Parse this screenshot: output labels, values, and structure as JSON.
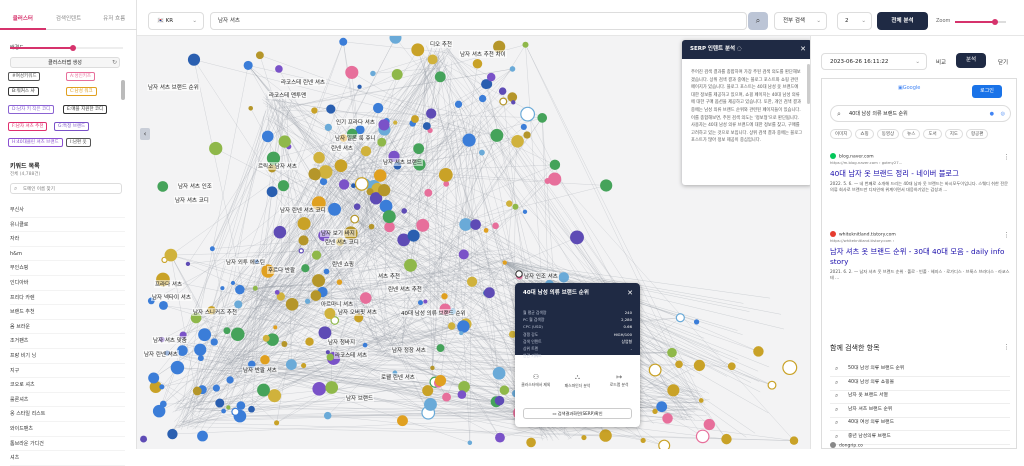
{
  "left_panel": {
    "tabs": [
      "클러스터",
      "검색인텐트",
      "유저 흐름"
    ],
    "active_tab": 0,
    "size_label": "배경도",
    "size_value": 0.56,
    "cluster_button": "클러스터맵 생성",
    "chips": [
      {
        "label": "#여성키워드",
        "color": "#555"
      },
      {
        "label": "A:성인키즈",
        "color": "#e76f9b"
      },
      {
        "label": "B:워커스 샤",
        "color": "#333"
      },
      {
        "label": "C:남성 워크",
        "color": "#e0a020"
      },
      {
        "label": "D:남자 키 작은 코디",
        "color": "#8a63d2"
      },
      {
        "label": "E:매플 지원한 코디",
        "color": "#333"
      },
      {
        "label": "F:남자 셔츠 추천",
        "color": "#e0306e"
      },
      {
        "label": "G:특정 브랜드",
        "color": "#7a52c8"
      },
      {
        "label": "H:40대클린 셔츠 브랜드",
        "color": "#8a4fd0"
      },
      {
        "label": "I:남편 옷",
        "color": "#555"
      }
    ],
    "keyword_title": "키워드 목록",
    "keyword_count": "전체 (4,788건)",
    "keyword_search_placeholder": "도메인 이름 찾기",
    "keywords": [
      "무신사",
      "유니클로",
      "자라",
      "h&m",
      "부인쇼핑",
      "인디아바",
      "프리다 카렌",
      "브랜드 추천",
      "옴 브라운",
      "조거팬츠",
      "프랑 비기 닝",
      "지구",
      "코오로 셔츠",
      "룰론셔츠",
      "옹 스타일 리스트",
      "와이드팬츠",
      "톰브라운 가디건",
      "셔츠"
    ]
  },
  "topbar": {
    "country": "🇰🇷 KR",
    "query": "남자 셔츠",
    "mode": "전부 검색",
    "depth": "2",
    "analyze_button": "전체 분석",
    "zoom_label": "Zoom",
    "zoom_value": 0.78
  },
  "graph": {
    "labels": [
      "디오 추천",
      "남자 셔츠 추천 차이",
      "라코스테 린넨 셔츠",
      "라코스테 맨투맨",
      "인기 프라다 셔츠",
      "남자 일론 룩 쥬니",
      "린넨 셔츠",
      "남자 셔츠 브랜드 순위",
      "남자 셔츠 브랜드",
      "르릭소 남자 셔츠",
      "남자 셔츠 인조",
      "남자 셔츠 코디",
      "남자 린넨 셔츠 코디",
      "남자 보기 바지",
      "린넨 셔츠 코디",
      "남자 외투 에스틴",
      "후르다 반팔",
      "프라다 셔츠",
      "남자 넥타이 셔츠",
      "린넨 셔츠 추천",
      "셔츠 추천",
      "린넨 쇼핑",
      "아르마니 셔츠",
      "남자 오버핏 셔츠",
      "남자 스니커즈 추천",
      "남자 인조 셔츠",
      "40대 남성 의류 브랜드 순위",
      "남자 셔츠 맞춤",
      "남자 린넨 셔츠",
      "남자 청바지",
      "남자 정장 셔츠",
      "남자 반팔 셔츠",
      "라코스테 셔츠",
      "로웰 린넨 셔츠",
      "남자 브랜드"
    ]
  },
  "serp_intent": {
    "title": "SERP 인텐트 분석",
    "body": "주어진 검색 결과를 종합하여 가장 주된 검색 의도를 판단해보겠습니다. 상위 검색 결과 중에는 블로그 포스트와 쇼핑 관련 페이지가 있습니다. 블로그 포스트는 40대 남성 옷 브랜드에 대한 정보를 제공하고 있으며, 쇼핑 페이지는 40대 남성 의류에 대한 구매 옵션을 제공하고 있습니다. 또한, 개인 검색 결과 중에는 남성 의류 브랜드 순위와 관련된 페이지들이 있습니다. 이를 종합해보면, 주된 검색 의도는 '정보형'으로 판단됩니다. 사용자는 40대 남성 의류 브랜드에 대한 정보를 찾고, 구매를 고려하고 있는 것으로 보입니다. 상위 검색 결과 중에는 블로그 포스트가 많아 정보 제공이 중심입니다."
  },
  "keyword_popup": {
    "title": "40대 남성 의류 브랜드 순위",
    "stats": [
      {
        "label": "월 평균 검색량",
        "value": "240"
      },
      {
        "label": "PC 월 검색량",
        "value": "2,280"
      },
      {
        "label": "CPC (USD)",
        "value": "0.66"
      },
      {
        "label": "경쟁 강도",
        "value": "HIGH/100"
      },
      {
        "label": "검색 인텐트",
        "value": "상업형"
      },
      {
        "label": "상위 트렌",
        "value": "-"
      },
      {
        "label": "연관 키워드",
        "value": "-"
      }
    ],
    "actions": [
      {
        "icon": "⚇",
        "label": "클러스터에서 제외"
      },
      {
        "icon": "⛬",
        "label": "패스파인더 분석"
      },
      {
        "icon": "↦",
        "label": "로드맵 분석"
      }
    ],
    "serp_button": "검색결과화면(SERP)확인"
  },
  "right_panel": {
    "date": "2023-06-26 16:11:22",
    "compare_label": "비교",
    "analysis_button": "분석",
    "close_label": "닫기",
    "google_logo": "Google",
    "login_button": "로그인",
    "search_query": "40대 남성 의류 브랜드 순위",
    "tabs": [
      "이미지",
      "쇼핑",
      "동영상",
      "뉴스",
      "도서",
      "지도",
      "항공편"
    ],
    "results": [
      {
        "site": "blog.naver.com",
        "url": "https://m.blog.naver.com › gotmy27...",
        "title": "40대 남자 옷 브랜드 정리 - 네이버 블로그",
        "snippet": "2022. 5. 6. — 네 번째로 소개해 드리는 40대 남자 옷 브랜드는 바시모두이입니다. 스웨디 쉬한 전문 의류 회사로 브랜드만 디자인에 위계이면서 대응하기있는 감성과 ...",
        "color": "#03c75a"
      },
      {
        "site": "whiteknitland.tistory.com",
        "url": "https://whiteknitland.tistory.com ›",
        "title": "남자 셔츠 옷 브랜드 순위 - 30대 40대 모음 - daily info story",
        "snippet": "2021. 6. 2. — 남자 셔츠 옷 브랜드 순위 · 폴로 · 빈폴 · 헤지스 · 로가디스 · 브룩스 브라더스 · 라코스테 ...",
        "color": "#e63b2e"
      }
    ],
    "related_title": "함께 검색한 항목",
    "related": [
      "50대 남성 의류 브랜드 순위",
      "40대 남성 의류 쇼핑몰",
      "남자 옷 브랜드 서열",
      "남자 셔츠 브랜드 순위",
      "40대 여성 의류 브랜드",
      "중년 남성의류 브랜드"
    ],
    "next_site": "dongrip.co"
  }
}
